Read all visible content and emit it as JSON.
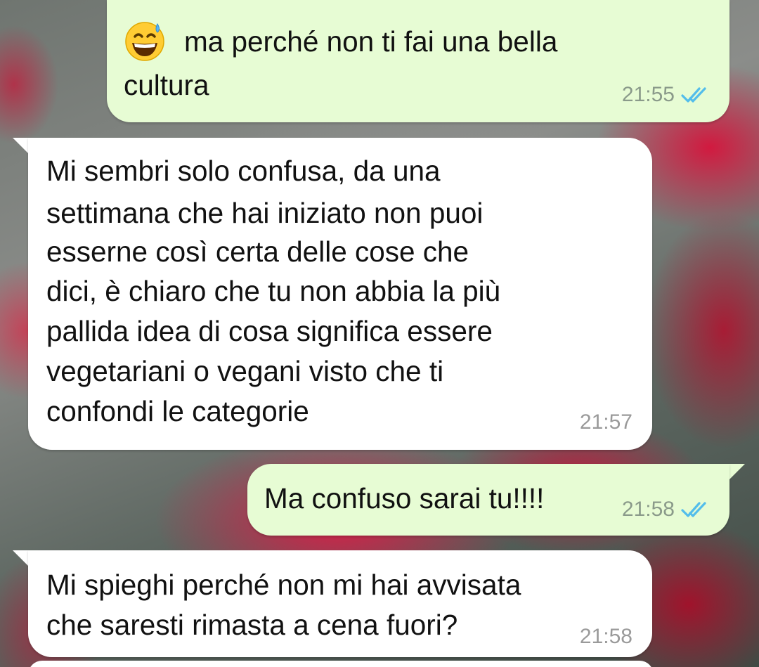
{
  "chat": {
    "messages": [
      {
        "direction": "outgoing",
        "emoji": "grinning-face-with-sweat-icon",
        "line1": "ma perché non ti fai una bella",
        "line2": "cultura",
        "time": "21:55",
        "status": "read"
      },
      {
        "direction": "incoming",
        "lines": [
          "Mi sembri solo confusa, da una",
          "settimana che hai iniziato non puoi",
          "esserne così certa delle cose che",
          "dici, è chiaro che tu non abbia la più",
          "pallida idea di cosa significa essere",
          "vegetariani o vegani visto che ti",
          "confondi le categorie"
        ],
        "time": "21:57"
      },
      {
        "direction": "outgoing",
        "text": "Ma confuso sarai tu!!!!",
        "time": "21:58",
        "status": "read"
      },
      {
        "direction": "incoming",
        "lines": [
          "Mi spieghi perché non mi hai avvisata",
          "che saresti rimasta a cena fuori?"
        ],
        "time": "21:58"
      }
    ]
  },
  "colors": {
    "outgoing_bubble": "#e7fcd4",
    "incoming_bubble": "#ffffff",
    "read_ticks": "#53bdeb",
    "timestamp": "#8a9a8a"
  }
}
